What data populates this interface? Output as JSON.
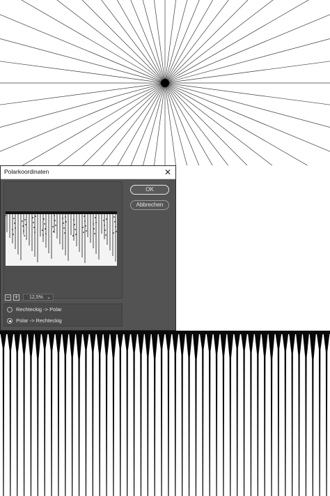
{
  "dialog": {
    "title": "Polarkoordinaten",
    "close_symbol": "✕",
    "ok_label": "OK",
    "cancel_label": "Abbrechen",
    "zoom_minus_symbol": "−",
    "zoom_plus_symbol": "+",
    "zoom_value": "12,5%",
    "zoom_chevron": "⌄",
    "options": [
      {
        "label": "Rechteckig -> Polar",
        "selected": false
      },
      {
        "label": "Polar -> Rechteckig",
        "selected": true
      }
    ]
  },
  "artwork": {
    "top": "radial-lines-starburst",
    "bottom": "vertical-stripes-polar-to-rect"
  }
}
